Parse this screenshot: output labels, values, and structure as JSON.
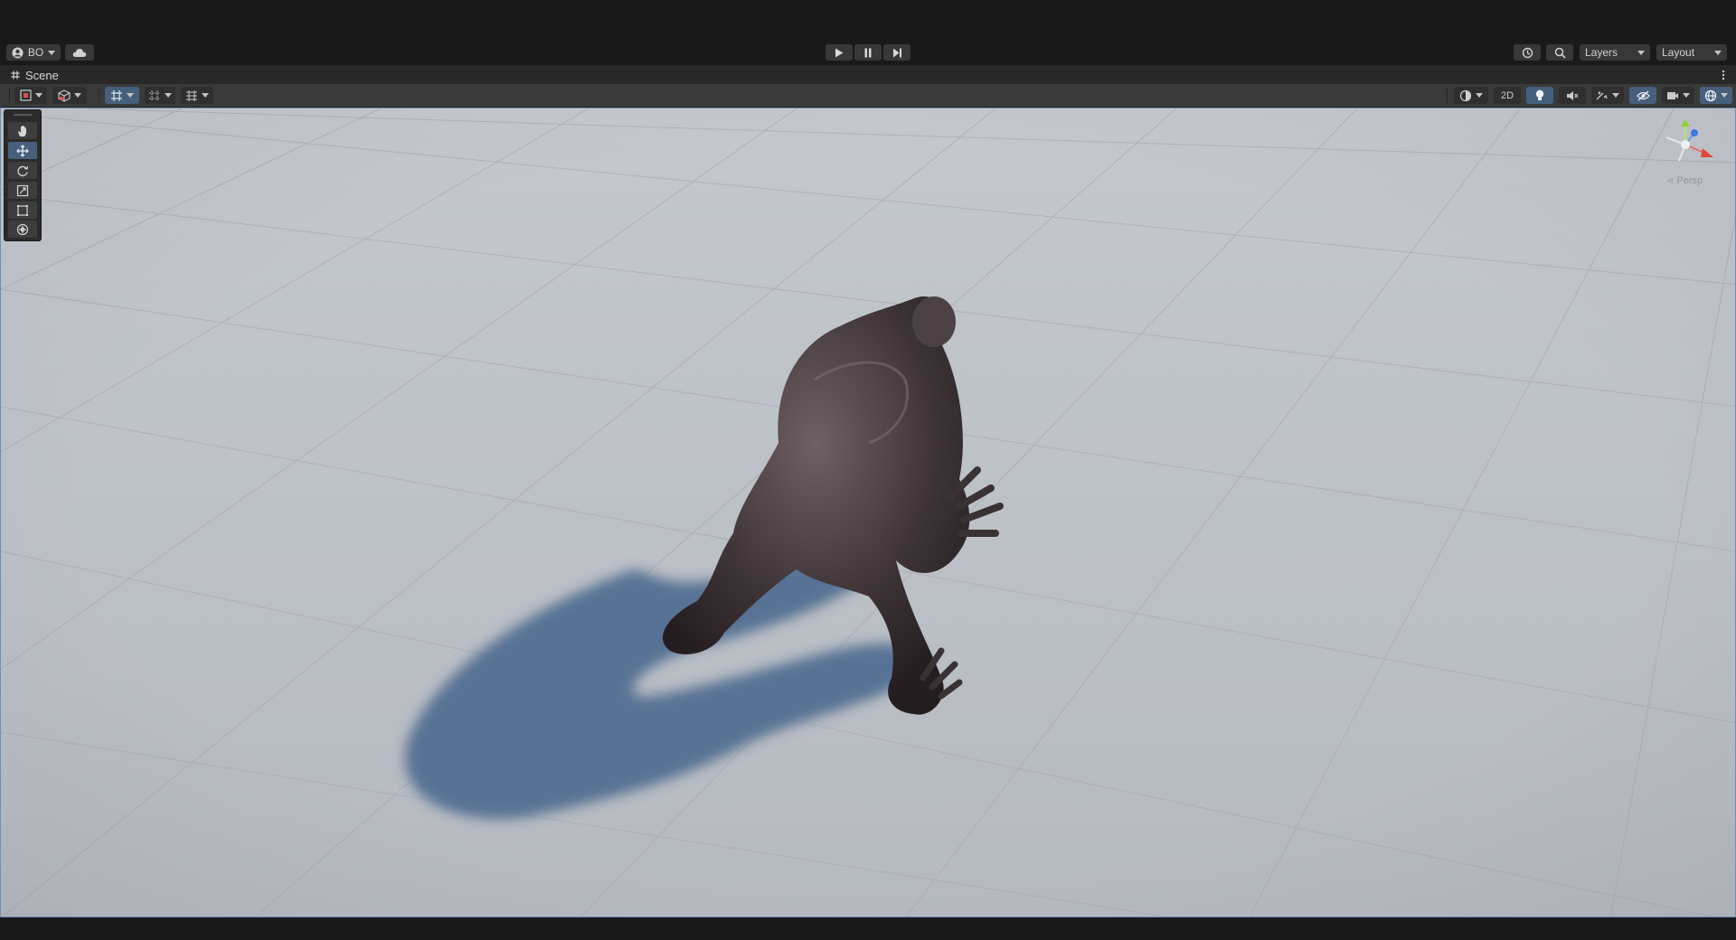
{
  "main_toolbar": {
    "account_label": "BO",
    "layers_label": "Layers",
    "layout_label": "Layout"
  },
  "scene_tab": {
    "label": "Scene"
  },
  "scene_toolbar": {
    "mode_2d_label": "2D"
  },
  "gizmo": {
    "projection_label": "Persp"
  },
  "colors": {
    "accent": "#46607c",
    "viewport_border": "#6d8fb8",
    "background": "#191919",
    "floor": "#bfc3ca",
    "shadow": "#4e6a8f"
  },
  "icons": {
    "tools": [
      "hand-icon",
      "move-icon",
      "rotate-icon",
      "scale-icon",
      "rect-icon",
      "transform-icon"
    ],
    "play_controls": [
      "play-icon",
      "pause-icon",
      "step-icon"
    ]
  }
}
